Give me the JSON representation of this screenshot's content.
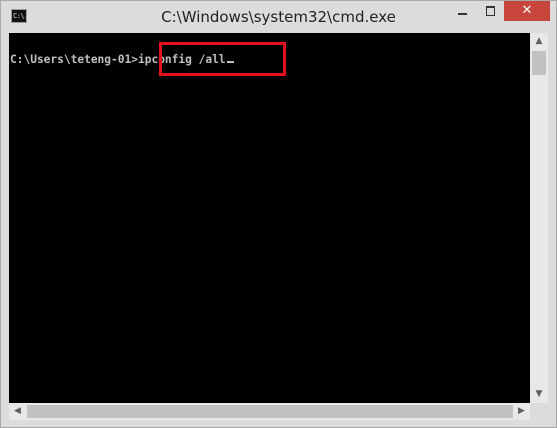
{
  "window": {
    "title": "C:\\Windows\\system32\\cmd.exe",
    "icon": "cmd-app-icon",
    "icon_text": "C:\\.",
    "controls": {
      "minimize": "minimize-icon",
      "maximize": "maximize-icon",
      "close_glyph": "✕"
    }
  },
  "console": {
    "prompt": "C:\\Users\\teteng-01>",
    "command": "ipconfig /all",
    "text_color": "#c0c0c0",
    "background": "#000000",
    "highlight_color": "#e3121e"
  },
  "scrollbars": {
    "up_arrow": "▲",
    "down_arrow": "▼",
    "left_arrow": "◀",
    "right_arrow": "▶"
  }
}
